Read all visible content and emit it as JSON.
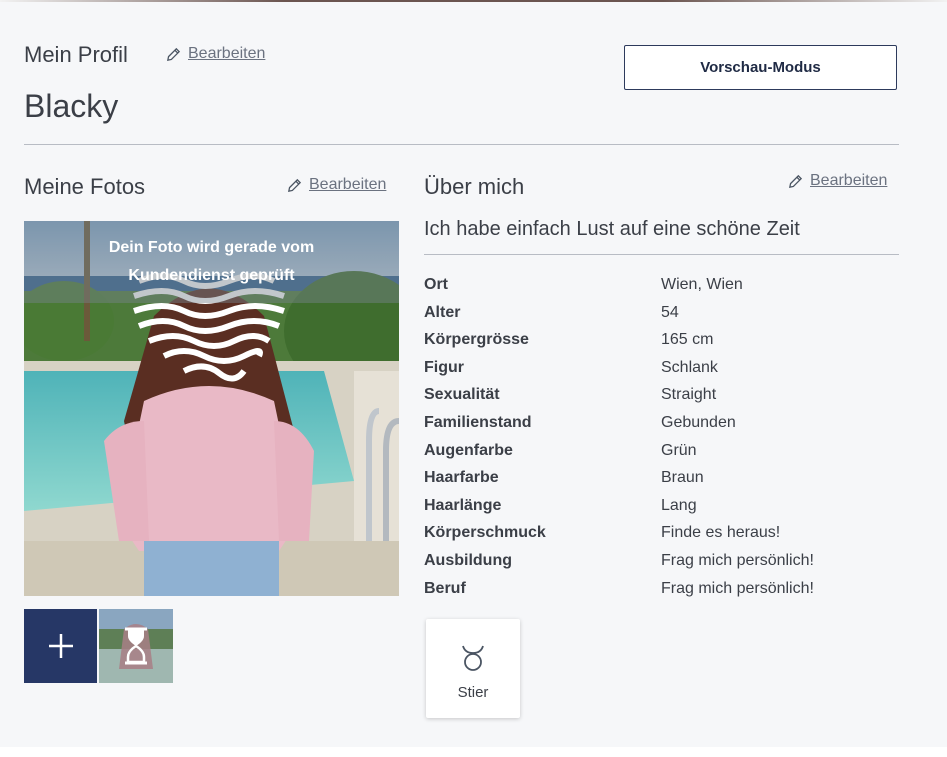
{
  "header": {
    "section_label": "Mein Profil",
    "edit_label": "Bearbeiten",
    "profile_name": "Blacky",
    "preview_button": "Vorschau-Modus"
  },
  "photos": {
    "title": "Meine Fotos",
    "edit_label": "Bearbeiten",
    "review_notice": "Dein Foto wird gerade vom Kundendienst geprüft",
    "add_icon": "plus-icon",
    "pending_icon": "hourglass-icon"
  },
  "about": {
    "title": "Über mich",
    "edit_label": "Bearbeiten",
    "tagline": "Ich habe einfach Lust auf eine schöne Zeit",
    "attributes": [
      {
        "key": "Ort",
        "value": "Wien, Wien"
      },
      {
        "key": "Alter",
        "value": "54"
      },
      {
        "key": "Körpergrösse",
        "value": "165 cm"
      },
      {
        "key": "Figur",
        "value": "Schlank"
      },
      {
        "key": "Sexualität",
        "value": "Straight"
      },
      {
        "key": "Familienstand",
        "value": "Gebunden"
      },
      {
        "key": "Augenfarbe",
        "value": "Grün"
      },
      {
        "key": "Haarfarbe",
        "value": "Braun"
      },
      {
        "key": "Haarlänge",
        "value": "Lang"
      },
      {
        "key": "Körperschmuck",
        "value": "Finde es heraus!"
      },
      {
        "key": "Ausbildung",
        "value": "Frag mich persönlich!"
      },
      {
        "key": "Beruf",
        "value": "Frag mich persönlich!"
      }
    ],
    "zodiac": {
      "label": "Stier",
      "icon": "taurus-icon"
    }
  },
  "colors": {
    "accent_navy": "#263766",
    "text": "#3b3f47",
    "link": "#6b7280",
    "background": "#f6f7f9"
  }
}
